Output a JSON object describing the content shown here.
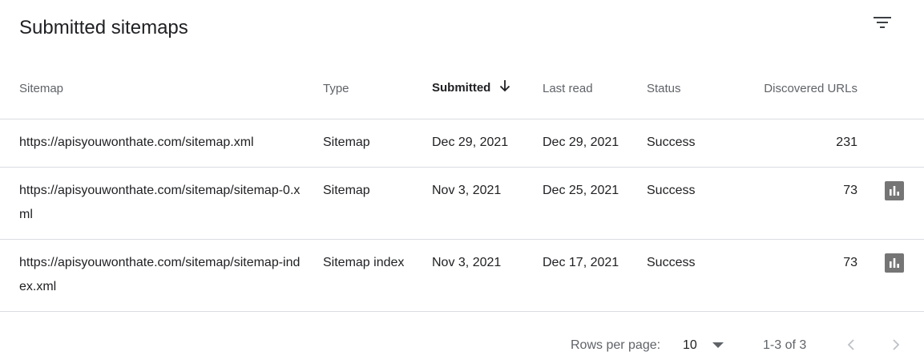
{
  "header": {
    "title": "Submitted sitemaps"
  },
  "table": {
    "columns": {
      "sitemap": "Sitemap",
      "type": "Type",
      "submitted": "Submitted",
      "last_read": "Last read",
      "status": "Status",
      "discovered": "Discovered URLs"
    },
    "sorted_by": "Submitted",
    "sort_direction": "descending",
    "rows": [
      {
        "sitemap": "https://apisyouwonthate.com/sitemap.xml",
        "type": "Sitemap",
        "submitted": "Dec 29, 2021",
        "last_read": "Dec 29, 2021",
        "status": "Success",
        "discovered": "231",
        "report_icon": ""
      },
      {
        "sitemap": "https://apisyouwonthate.com/sitemap/sitemap-0.xml",
        "type": "Sitemap",
        "submitted": "Nov 3, 2021",
        "last_read": "Dec 25, 2021",
        "status": "Success",
        "discovered": "73",
        "report_icon": "bar-chart-icon"
      },
      {
        "sitemap": "https://apisyouwonthate.com/sitemap/sitemap-index.xml",
        "type": "Sitemap index",
        "submitted": "Nov 3, 2021",
        "last_read": "Dec 17, 2021",
        "status": "Success",
        "discovered": "73",
        "report_icon": "bar-chart-icon"
      }
    ]
  },
  "pagination": {
    "rows_per_page_label": "Rows per page:",
    "rows_per_page_value": "10",
    "range": "1-3 of 3"
  },
  "icons": {
    "filter": "filter-icon",
    "sort": "arrow-down-icon",
    "dropdown": "caret-down-icon",
    "prev": "chevron-left-icon",
    "next": "chevron-right-icon"
  },
  "colors": {
    "status_success": "#1e8e3e",
    "text_primary": "#202124",
    "text_secondary": "#5f6368",
    "divider": "#dadce0",
    "report_icon_bg": "#757575"
  }
}
